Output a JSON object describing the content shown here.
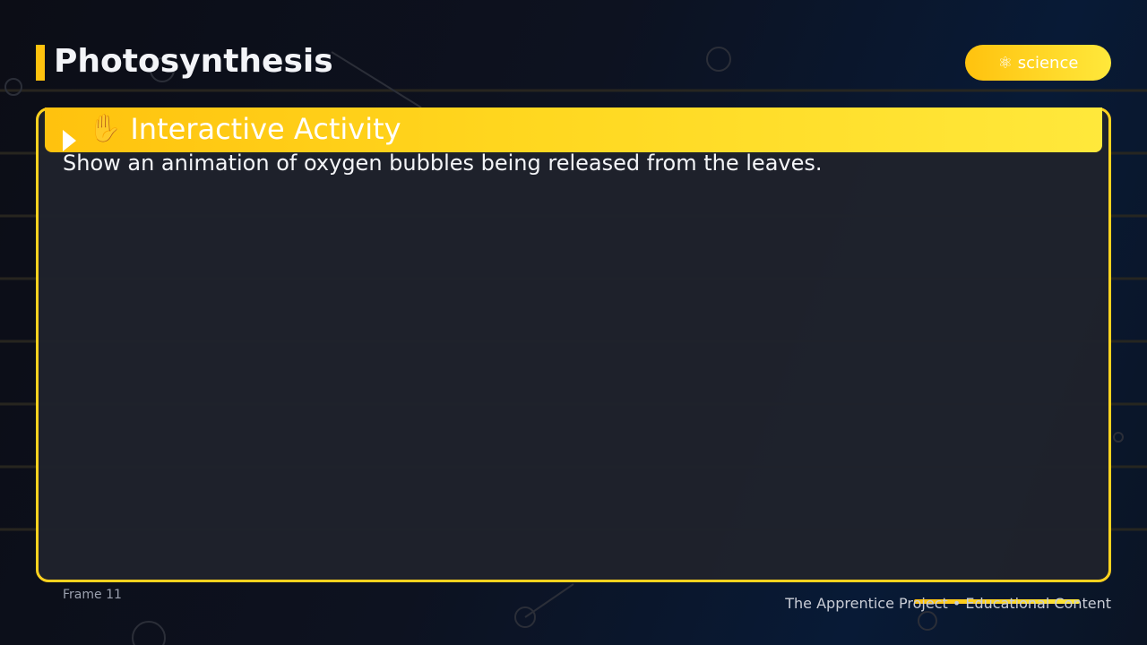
{
  "header": {
    "title": "Photosynthesis",
    "badge_icon": "⚛",
    "badge_label": "science"
  },
  "card": {
    "heading_icon": "✋",
    "heading": "Interactive Activity",
    "body": "Show an animation of oxygen bubbles being released from the leaves."
  },
  "footer": {
    "frame_label": "Frame 11",
    "credit": "The Apprentice Project • Educational Content"
  },
  "colors": {
    "accent": "#ffc20e",
    "accent_light": "#ffe83b",
    "card_bg": "#1f222c"
  }
}
